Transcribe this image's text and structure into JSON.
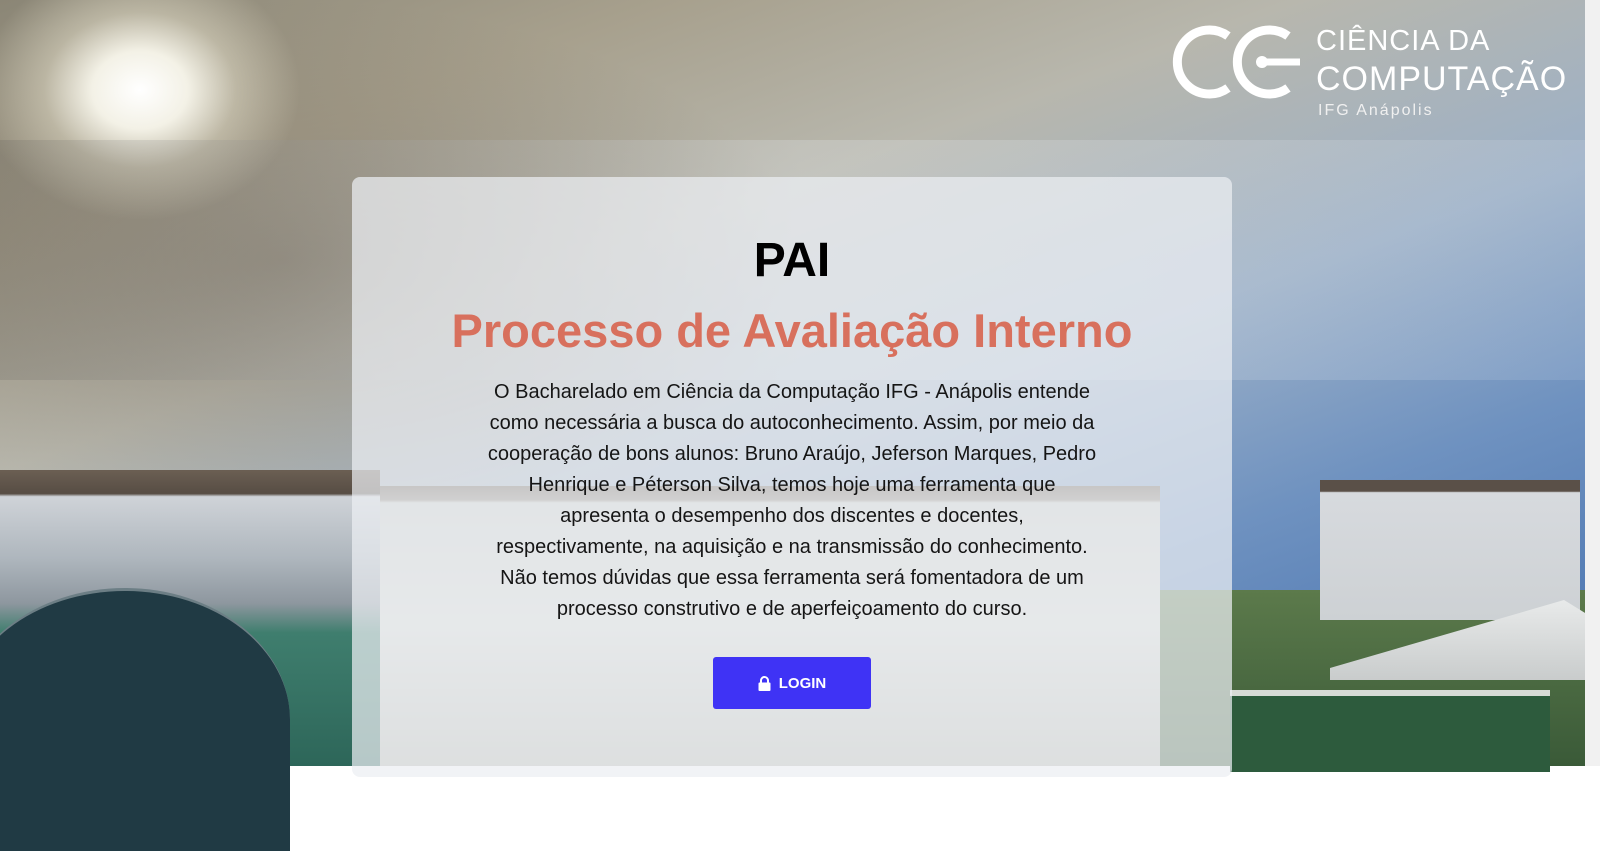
{
  "logo": {
    "line1": "CIÊNCIA DA",
    "line2": "COMPUTAÇÃO",
    "line3": "IFG Anápolis"
  },
  "card": {
    "title": "PAI",
    "subtitle": "Processo de Avaliação Interno",
    "description": "O Bacharelado em Ciência da Computação IFG - Anápolis entende como necessária a busca do autoconhecimento. Assim, por meio da cooperação de bons alunos: Bruno Araújo, Jeferson Marques, Pedro Henrique e Péterson Silva, temos hoje uma ferramenta que apresenta o desempenho dos discentes e docentes, respectivamente, na aquisição e na transmissão do conhecimento. Não temos dúvidas que essa ferramenta será fomentadora de um processo construtivo e de aperfeiçoamento do curso.",
    "login_label": "LOGIN",
    "login_icon": "lock-icon"
  },
  "colors": {
    "subtitle": "#d8705d",
    "login_button": "#3f33f5"
  }
}
